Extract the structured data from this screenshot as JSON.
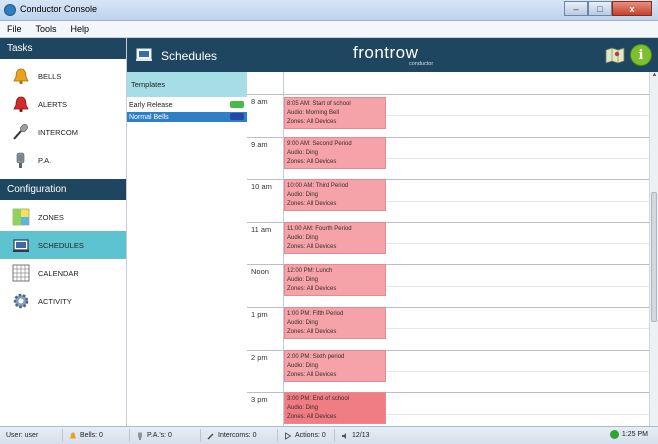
{
  "window": {
    "title": "Conductor Console",
    "min": "–",
    "max": "□",
    "close": "x"
  },
  "menu": [
    "File",
    "Tools",
    "Help"
  ],
  "nav": {
    "tasks_label": "Tasks",
    "tasks": [
      {
        "label": "BELLS",
        "icon": "bell-icon"
      },
      {
        "label": "ALERTS",
        "icon": "alert-bell-icon"
      },
      {
        "label": "INTERCOM",
        "icon": "microphone-icon"
      },
      {
        "label": "P.A.",
        "icon": "pa-microphone-icon"
      }
    ],
    "config_label": "Configuration",
    "config": [
      {
        "label": "ZONES",
        "icon": "zones-icon"
      },
      {
        "label": "SCHEDULES",
        "icon": "schedules-icon"
      },
      {
        "label": "CALENDAR",
        "icon": "calendar-icon"
      },
      {
        "label": "ACTIVITY",
        "icon": "gear-icon"
      }
    ]
  },
  "header": {
    "title": "Schedules",
    "brand": "frontrow",
    "brand_sub": "conductor",
    "info": "i"
  },
  "templates": {
    "label": "Templates",
    "items": [
      {
        "name": "Early Release",
        "color": "#4cb848"
      },
      {
        "name": "Normal Bells",
        "color": "#2447a8"
      }
    ]
  },
  "schedule": {
    "hours": [
      "8 am",
      "9 am",
      "10 am",
      "11 am",
      "Noon",
      "1 pm",
      "2 pm",
      "3 pm"
    ],
    "events": [
      {
        "title": "8:05 AM: Start of school",
        "audio": "Audio: Morning Bell",
        "zones": "Zones: All Devices"
      },
      {
        "title": "9:00 AM: Second Period",
        "audio": "Audio: Ding",
        "zones": "Zones: All Devices"
      },
      {
        "title": "10:00 AM: Third Period",
        "audio": "Audio: Ding",
        "zones": "Zones: All Devices"
      },
      {
        "title": "11:00 AM: Fourth Period",
        "audio": "Audio: Ding",
        "zones": "Zones: All Devices"
      },
      {
        "title": "12:00 PM: Lunch",
        "audio": "Audio: Ding",
        "zones": "Zones: All Devices"
      },
      {
        "title": "1:00 PM: Fifth Period",
        "audio": "Audio: Ding",
        "zones": "Zones: All Devices"
      },
      {
        "title": "2:00 PM: Sixth period",
        "audio": "Audio: Ding",
        "zones": "Zones: All Devices"
      },
      {
        "title": "3:00 PM: End of school",
        "audio": "Audio: Ding",
        "zones": "Zones: All Devices"
      }
    ]
  },
  "status": {
    "user": "User: user",
    "bells": "Bells: 0",
    "pas": "P.A.'s: 0",
    "intercoms": "Intercoms: 0",
    "actions": "Actions: 0",
    "volume": "12/13",
    "time": "1:25 PM"
  },
  "colors": {
    "nav_header": "#1f4660",
    "selected": "#5ec3d1",
    "event": "#f5a3a8",
    "online": "#2fa52f"
  }
}
